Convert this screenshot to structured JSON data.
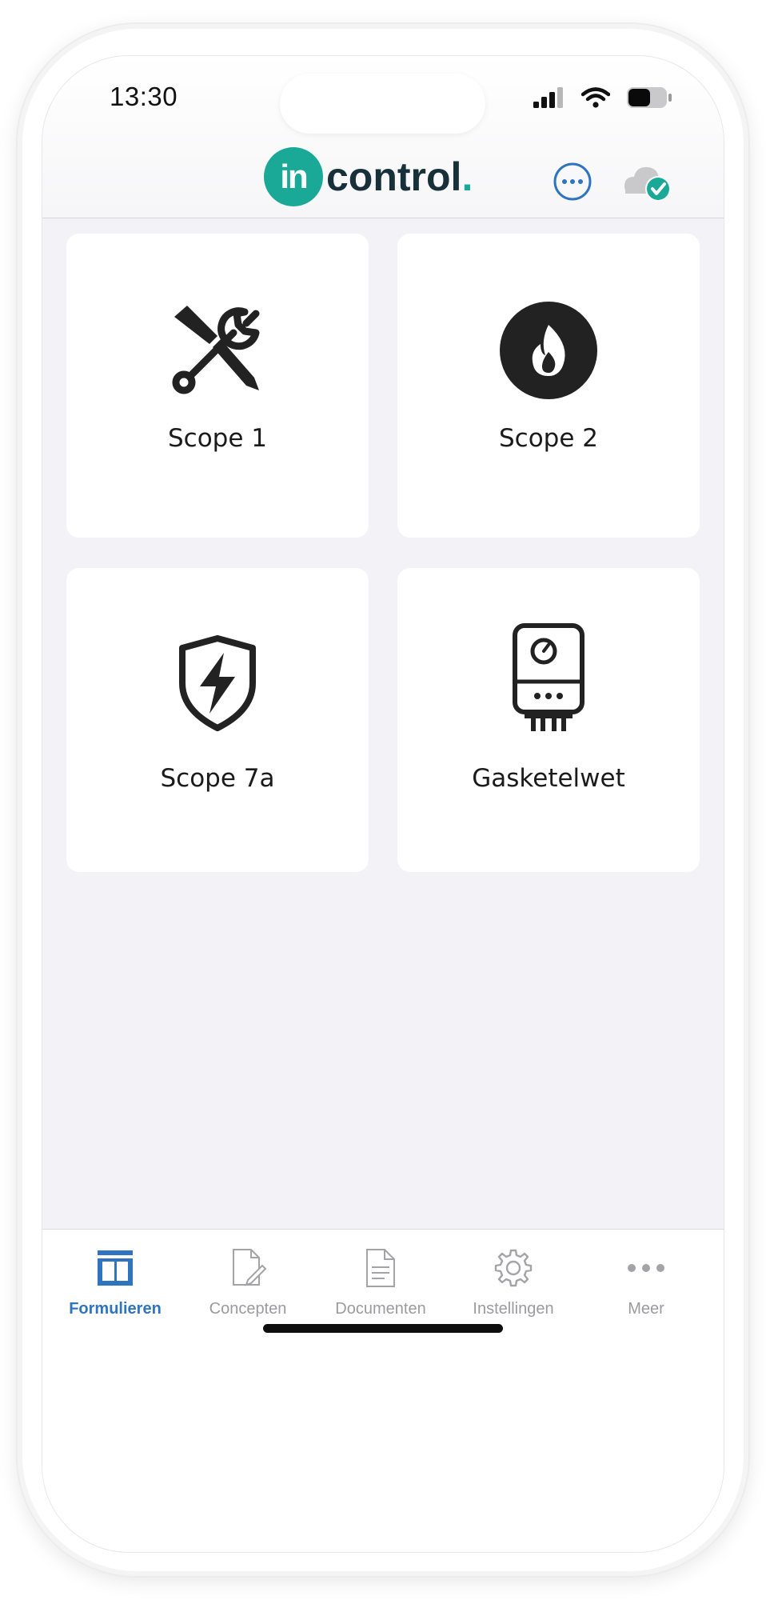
{
  "status_bar": {
    "time": "13:30"
  },
  "header": {
    "logo_badge": "in",
    "logo_word": "control",
    "logo_dot": "."
  },
  "cards": [
    {
      "label": "Scope 1",
      "icon": "tools-icon"
    },
    {
      "label": "Scope 2",
      "icon": "flame-icon"
    },
    {
      "label": "Scope 7a",
      "icon": "shield-bolt-icon"
    },
    {
      "label": "Gasketelwet",
      "icon": "boiler-icon"
    }
  ],
  "tabs": [
    {
      "label": "Formulieren",
      "icon": "forms-icon",
      "active": true
    },
    {
      "label": "Concepten",
      "icon": "draft-icon",
      "active": false
    },
    {
      "label": "Documenten",
      "icon": "document-icon",
      "active": false
    },
    {
      "label": "Instellingen",
      "icon": "gear-icon",
      "active": false
    },
    {
      "label": "Meer",
      "icon": "more-icon",
      "active": false
    }
  ],
  "colors": {
    "brand_teal": "#1aa997",
    "brand_dark": "#17303a",
    "tab_active": "#2f74c0",
    "tab_inactive": "#9b9b9f"
  }
}
